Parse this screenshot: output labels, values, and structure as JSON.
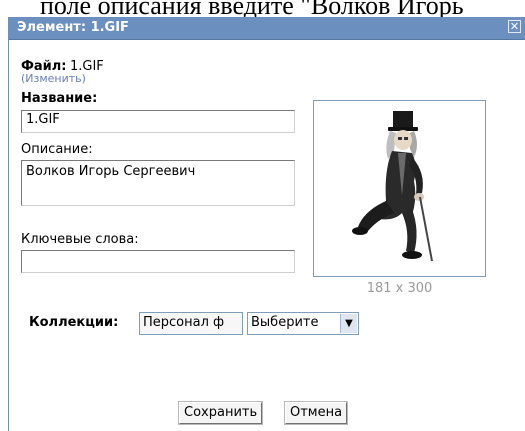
{
  "background": {
    "text": "поле описания введите \"Волков Игорь"
  },
  "dialog": {
    "title": "Элемент: 1.GIF",
    "close_icon": "close-icon",
    "file_label": "Файл:",
    "file_value": "1.GIF",
    "change_link": "(Изменить)",
    "name_label": "Название:",
    "name_value": "1.GIF",
    "description_label": "Описание:",
    "description_value": "Волков Игорь Сергеевич",
    "keywords_label": "Ключевые слова:",
    "keywords_value": "",
    "image_size": "181 x 300",
    "collections_label": "Коллекции:",
    "collection_button": "Персонал ф",
    "collection_select": "Выберите",
    "save_button": "Сохранить",
    "cancel_button": "Отмена"
  },
  "colors": {
    "titlebar": "#6b8fbf",
    "link": "#6a7fb1",
    "border": "#7f9db9"
  }
}
